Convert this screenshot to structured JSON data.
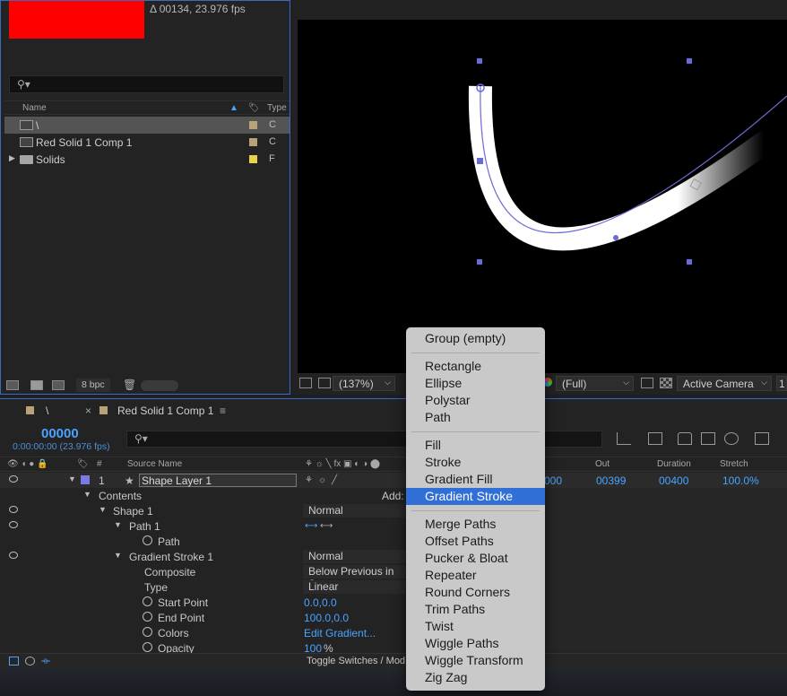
{
  "project": {
    "info": "Δ 00134, 23.976 fps",
    "columns": {
      "name": "Name",
      "type": "Type"
    },
    "items": [
      {
        "name": "\\",
        "type": "C",
        "label_color": "#b9a178",
        "selected": true
      },
      {
        "name": "Red Solid 1 Comp 1",
        "type": "C",
        "label_color": "#b9a178",
        "selected": false
      },
      {
        "name": "Solids",
        "type": "F",
        "label_color": "#e6d34a",
        "selected": false
      }
    ],
    "bpc": "8 bpc",
    "thumbnail_color": "#ff0000"
  },
  "viewer": {
    "zoom": "(137%)",
    "resolution": "(Full)",
    "camera": "Active Camera",
    "views_partial": "1"
  },
  "timeline": {
    "tabs": [
      {
        "label": "\\",
        "active": false
      },
      {
        "label": "Red Solid 1 Comp 1",
        "active": true
      }
    ],
    "timecode": "00000",
    "timecode_sub": "0:00:00:00 (23.976 fps)",
    "headers": {
      "hash": "#",
      "source_name": "Source Name",
      "out": "Out",
      "duration": "Duration",
      "stretch": "Stretch"
    },
    "layer": {
      "number": "1",
      "name": "Shape Layer 1",
      "in_partial": "000",
      "out": "00399",
      "duration": "00400",
      "stretch": "100.0%"
    },
    "rows": {
      "contents": "Contents",
      "add_label": "Add:",
      "shape": "Shape 1",
      "shape_mode": "Normal",
      "path_group": "Path 1",
      "path": "Path",
      "gradient_stroke": "Gradient Stroke 1",
      "gradient_mode": "Normal",
      "composite": "Composite",
      "composite_value": "Below Previous in Sa",
      "type": "Type",
      "type_value": "Linear",
      "start_point": "Start Point",
      "start_point_value": "0.0,0.0",
      "end_point": "End Point",
      "end_point_value": "100.0,0.0",
      "colors": "Colors",
      "colors_value": "Edit Gradient...",
      "opacity": "Opacity",
      "opacity_value": "100",
      "opacity_unit": "%"
    },
    "footer": "Toggle Switches / Mod"
  },
  "add_menu": {
    "items": [
      {
        "label": "Group (empty)",
        "selected": false
      },
      {
        "label": "Rectangle",
        "selected": false
      },
      {
        "label": "Ellipse",
        "selected": false
      },
      {
        "label": "Polystar",
        "selected": false
      },
      {
        "label": "Path",
        "selected": false
      },
      {
        "label": "Fill",
        "selected": false
      },
      {
        "label": "Stroke",
        "selected": false
      },
      {
        "label": "Gradient Fill",
        "selected": false
      },
      {
        "label": "Gradient Stroke",
        "selected": true
      },
      {
        "label": "Merge Paths",
        "selected": false
      },
      {
        "label": "Offset Paths",
        "selected": false
      },
      {
        "label": "Pucker & Bloat",
        "selected": false
      },
      {
        "label": "Repeater",
        "selected": false
      },
      {
        "label": "Round Corners",
        "selected": false
      },
      {
        "label": "Trim Paths",
        "selected": false
      },
      {
        "label": "Twist",
        "selected": false
      },
      {
        "label": "Wiggle Paths",
        "selected": false
      },
      {
        "label": "Wiggle Transform",
        "selected": false
      },
      {
        "label": "Zig Zag",
        "selected": false
      }
    ]
  },
  "colors": {
    "accent": "#2f6fd6",
    "timecode": "#4aa3ff",
    "panel_border": "#3a6bbf"
  }
}
